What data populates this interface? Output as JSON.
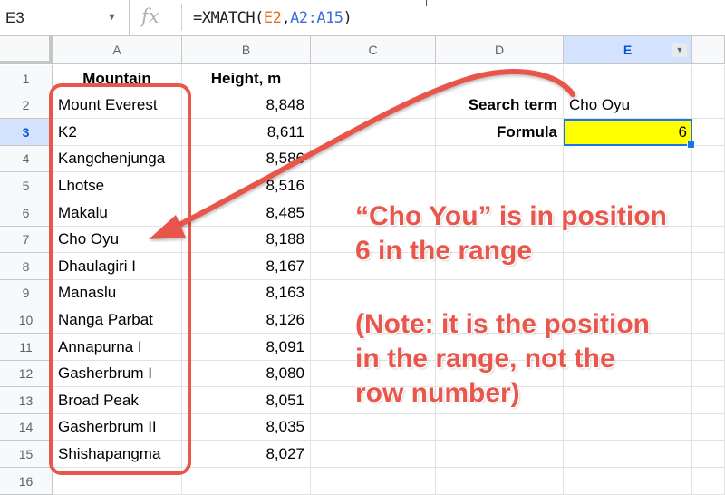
{
  "formula_bar": {
    "cell_ref": "E3",
    "fx_label": "fx",
    "formula_prefix": "=XMATCH(",
    "formula_ref1": "E2",
    "formula_comma": ",",
    "formula_ref2": "A2:A15",
    "formula_suffix": ")"
  },
  "columns": [
    "A",
    "B",
    "C",
    "D",
    "E"
  ],
  "rows": [
    "1",
    "2",
    "3",
    "4",
    "5",
    "6",
    "7",
    "8",
    "9",
    "10",
    "11",
    "12",
    "13",
    "14",
    "15",
    "16"
  ],
  "headers": {
    "mountain": "Mountain",
    "height": "Height, m"
  },
  "mountains": [
    {
      "name": "Mount Everest",
      "height": "8,848"
    },
    {
      "name": "K2",
      "height": "8,611"
    },
    {
      "name": "Kangchenjunga",
      "height": "8,586"
    },
    {
      "name": "Lhotse",
      "height": "8,516"
    },
    {
      "name": "Makalu",
      "height": "8,485"
    },
    {
      "name": "Cho Oyu",
      "height": "8,188"
    },
    {
      "name": "Dhaulagiri I",
      "height": "8,167"
    },
    {
      "name": "Manaslu",
      "height": "8,163"
    },
    {
      "name": "Nanga Parbat",
      "height": "8,126"
    },
    {
      "name": "Annapurna I",
      "height": "8,091"
    },
    {
      "name": "Gasherbrum I",
      "height": "8,080"
    },
    {
      "name": "Broad Peak",
      "height": "8,051"
    },
    {
      "name": "Gasherbrum II",
      "height": "8,035"
    },
    {
      "name": "Shishapangma",
      "height": "8,027"
    }
  ],
  "search": {
    "label": "Search term",
    "value": "Cho Oyu"
  },
  "formula_row": {
    "label": "Formula",
    "value": "6"
  },
  "annotation": {
    "line1": "“Cho You” is in position",
    "line2": "6 in the range",
    "line3": "(Note: it is the position",
    "line4": "in the range, not the",
    "line5": "row number)"
  },
  "colors": {
    "annotation": "#e8564c",
    "selection": "#1a73e8",
    "highlight_fill": "#ffff00"
  }
}
